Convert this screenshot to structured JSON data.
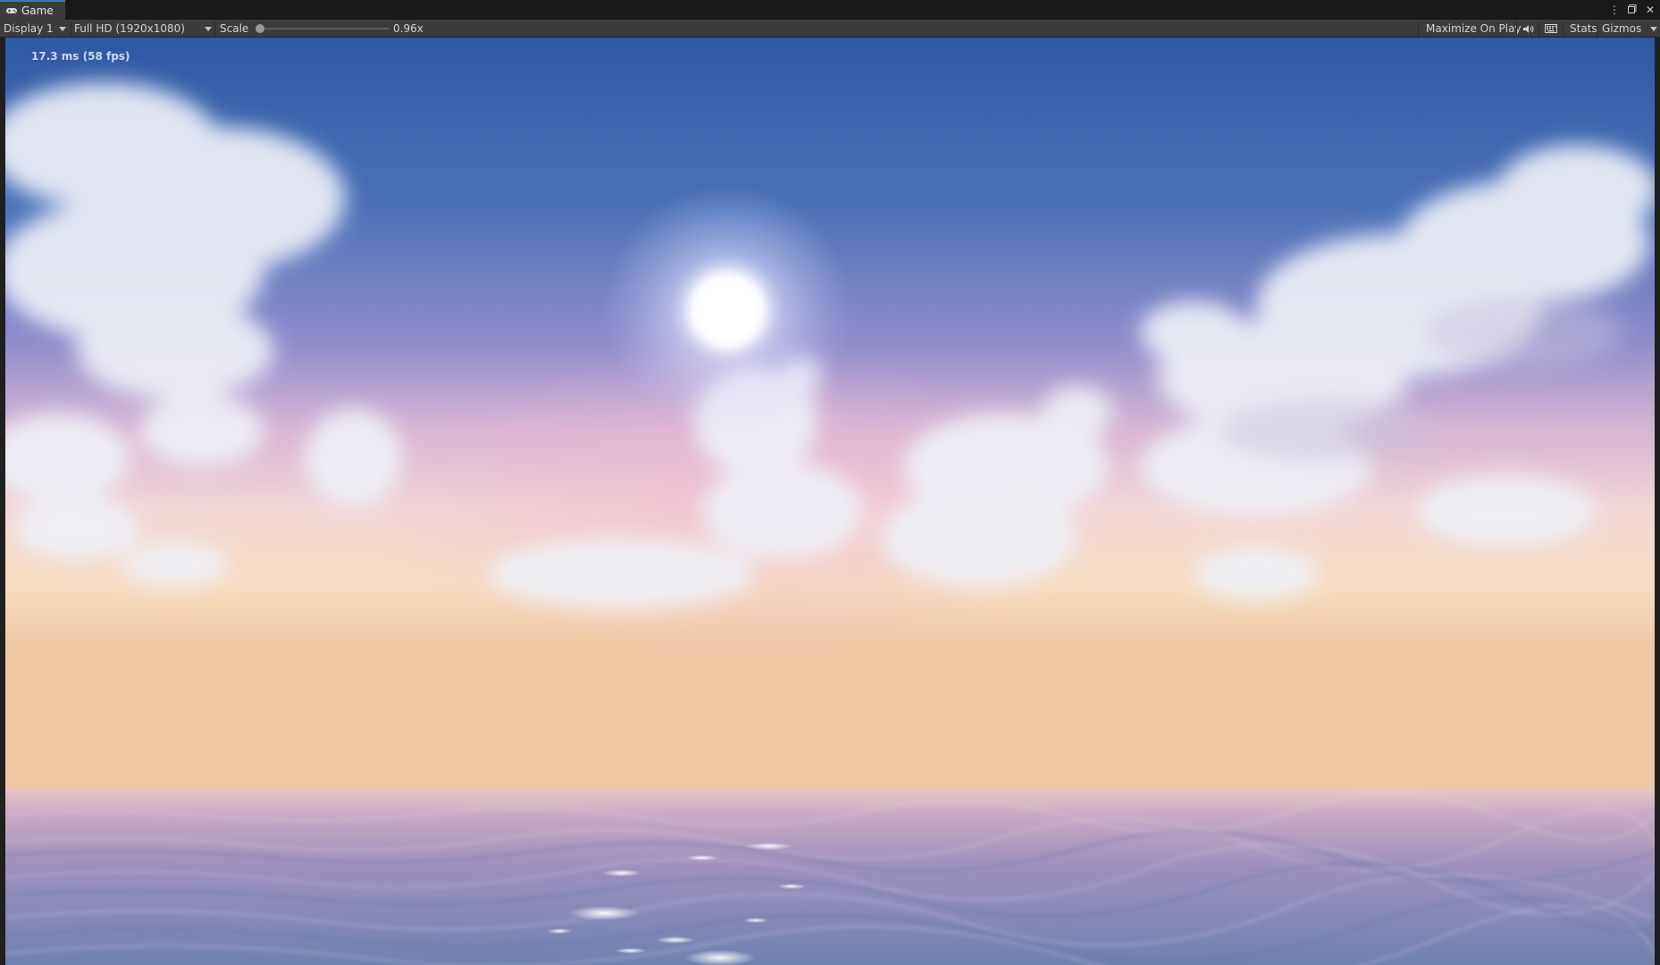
{
  "window": {
    "tab_label": "Game",
    "tab_icon": "gamepad-icon",
    "controls": [
      "more-options-icon",
      "maximize-icon",
      "close-icon"
    ]
  },
  "toolbar": {
    "display": "Display 1",
    "resolution": "Full HD (1920x1080)",
    "scale_label": "Scale",
    "scale_value_text": "0.96x",
    "scale_fraction": 0.0,
    "maximize_on_play": "Maximize On Play",
    "audio_icon": "speaker-icon",
    "keyboard_icon": "keyboard-icon",
    "stats": "Stats",
    "gizmos": "Gizmos"
  },
  "viewport": {
    "frame_time": "17.3 ms (58 fps)"
  },
  "colors": {
    "accent": "#3a79bb",
    "panel": "#3c3c3c",
    "sky_top": "#2f5aa6",
    "sky_mid": "#9b8fcf",
    "horizon": "#f6dfc3",
    "sea": "#8b8ab8"
  }
}
